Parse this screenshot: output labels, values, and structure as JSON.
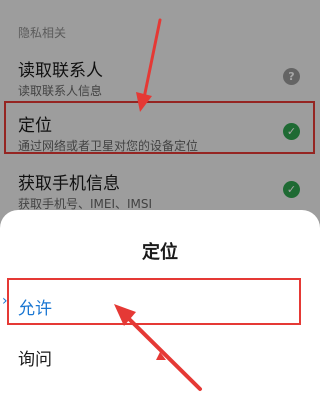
{
  "settings": {
    "section_label": "隐私相关",
    "items": [
      {
        "title": "读取联系人",
        "subtitle": "读取联系人信息",
        "status": "unknown",
        "status_glyph": "?"
      },
      {
        "title": "定位",
        "subtitle": "通过网络或者卫星对您的设备定位",
        "status": "granted",
        "status_glyph": "✓"
      },
      {
        "title": "获取手机信息",
        "subtitle": "获取手机号、IMEI、IMSI",
        "status": "granted",
        "status_glyph": "✓"
      }
    ]
  },
  "dialog": {
    "title": "定位",
    "options": [
      {
        "label": "允许",
        "selected": true
      },
      {
        "label": "询问",
        "selected": false
      }
    ]
  },
  "colors": {
    "accent": "#1976d2",
    "granted": "#2ea44f",
    "annotation": "#e53935"
  },
  "icons": {
    "unknown": "question-mark-icon",
    "granted": "check-icon",
    "annotation_arrow": "red-arrow-icon"
  }
}
